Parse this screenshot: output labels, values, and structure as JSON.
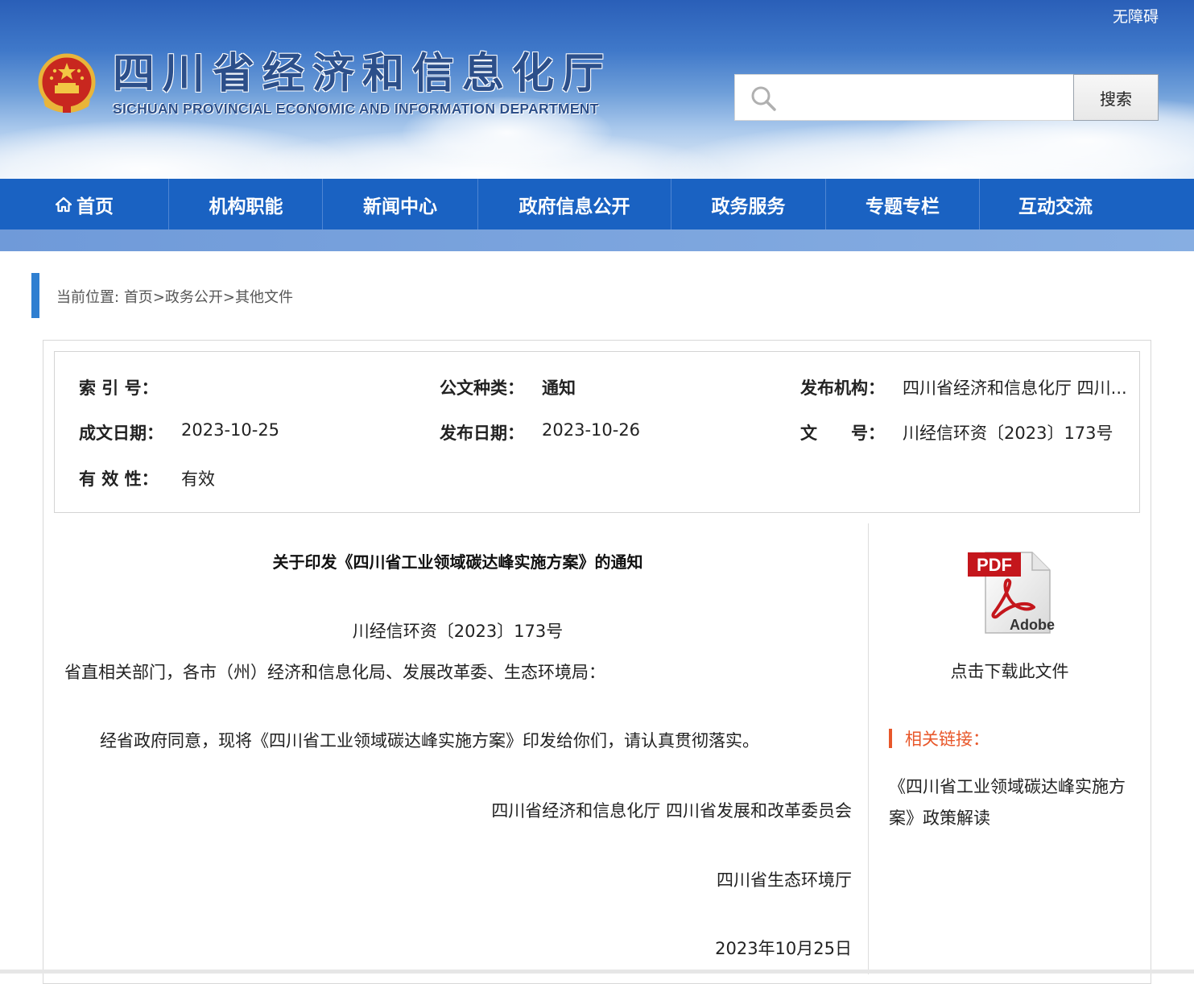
{
  "header": {
    "accessibility": "无障碍",
    "title_cn": "四川省经济和信息化厅",
    "title_en": "SICHUAN PROVINCIAL ECONOMIC AND INFORMATION DEPARTMENT",
    "search_placeholder": "",
    "search_button": "搜索"
  },
  "nav": {
    "items": [
      {
        "label": "首页",
        "icon": "home-icon"
      },
      {
        "label": "机构职能"
      },
      {
        "label": "新闻中心"
      },
      {
        "label": "政府信息公开"
      },
      {
        "label": "政务服务"
      },
      {
        "label": "专题专栏"
      },
      {
        "label": "互动交流"
      }
    ]
  },
  "breadcrumb": {
    "prefix": "当前位置:",
    "items": [
      "首页",
      "政务公开",
      "其他文件"
    ],
    "separator": ">"
  },
  "meta": {
    "index_label": "索 引 号：",
    "index_value": "",
    "type_label": "公文种类：",
    "type_value": "通知",
    "publisher_label": "发布机构：",
    "publisher_value": "四川省经济和信息化厅 四川...",
    "created_label": "成文日期：",
    "created_value": "2023-10-25",
    "published_label": "发布日期：",
    "published_value": "2023-10-26",
    "docno_label": "文　　号：",
    "docno_value": "川经信环资〔2023〕173号",
    "validity_label": "有 效 性：",
    "validity_value": "有效"
  },
  "document": {
    "title": "关于印发《四川省工业领域碳达峰实施方案》的通知",
    "number": "川经信环资〔2023〕173号",
    "recipients": "省直相关部门，各市（州）经济和信息化局、发展改革委、生态环境局：",
    "body": "经省政府同意，现将《四川省工业领域碳达峰实施方案》印发给你们，请认真贯彻落实。",
    "issuer1": "四川省经济和信息化厅 四川省发展和改革委员会",
    "issuer2": "四川省生态环境厅",
    "date": "2023年10月25日"
  },
  "sidebar": {
    "pdf_icon": "pdf-adobe-icon",
    "pdf_label_top": "PDF",
    "pdf_label_bottom": "Adobe",
    "download_label": "点击下载此文件",
    "related_title": "相关链接：",
    "related_links": [
      "《四川省工业领域碳达峰实施方案》政策解读"
    ]
  },
  "colors": {
    "nav_blue": "#1a62c2",
    "accent_orange": "#e8572a",
    "crumb_bar": "#2f7fd1",
    "title_blue": "#2c4f8a"
  }
}
